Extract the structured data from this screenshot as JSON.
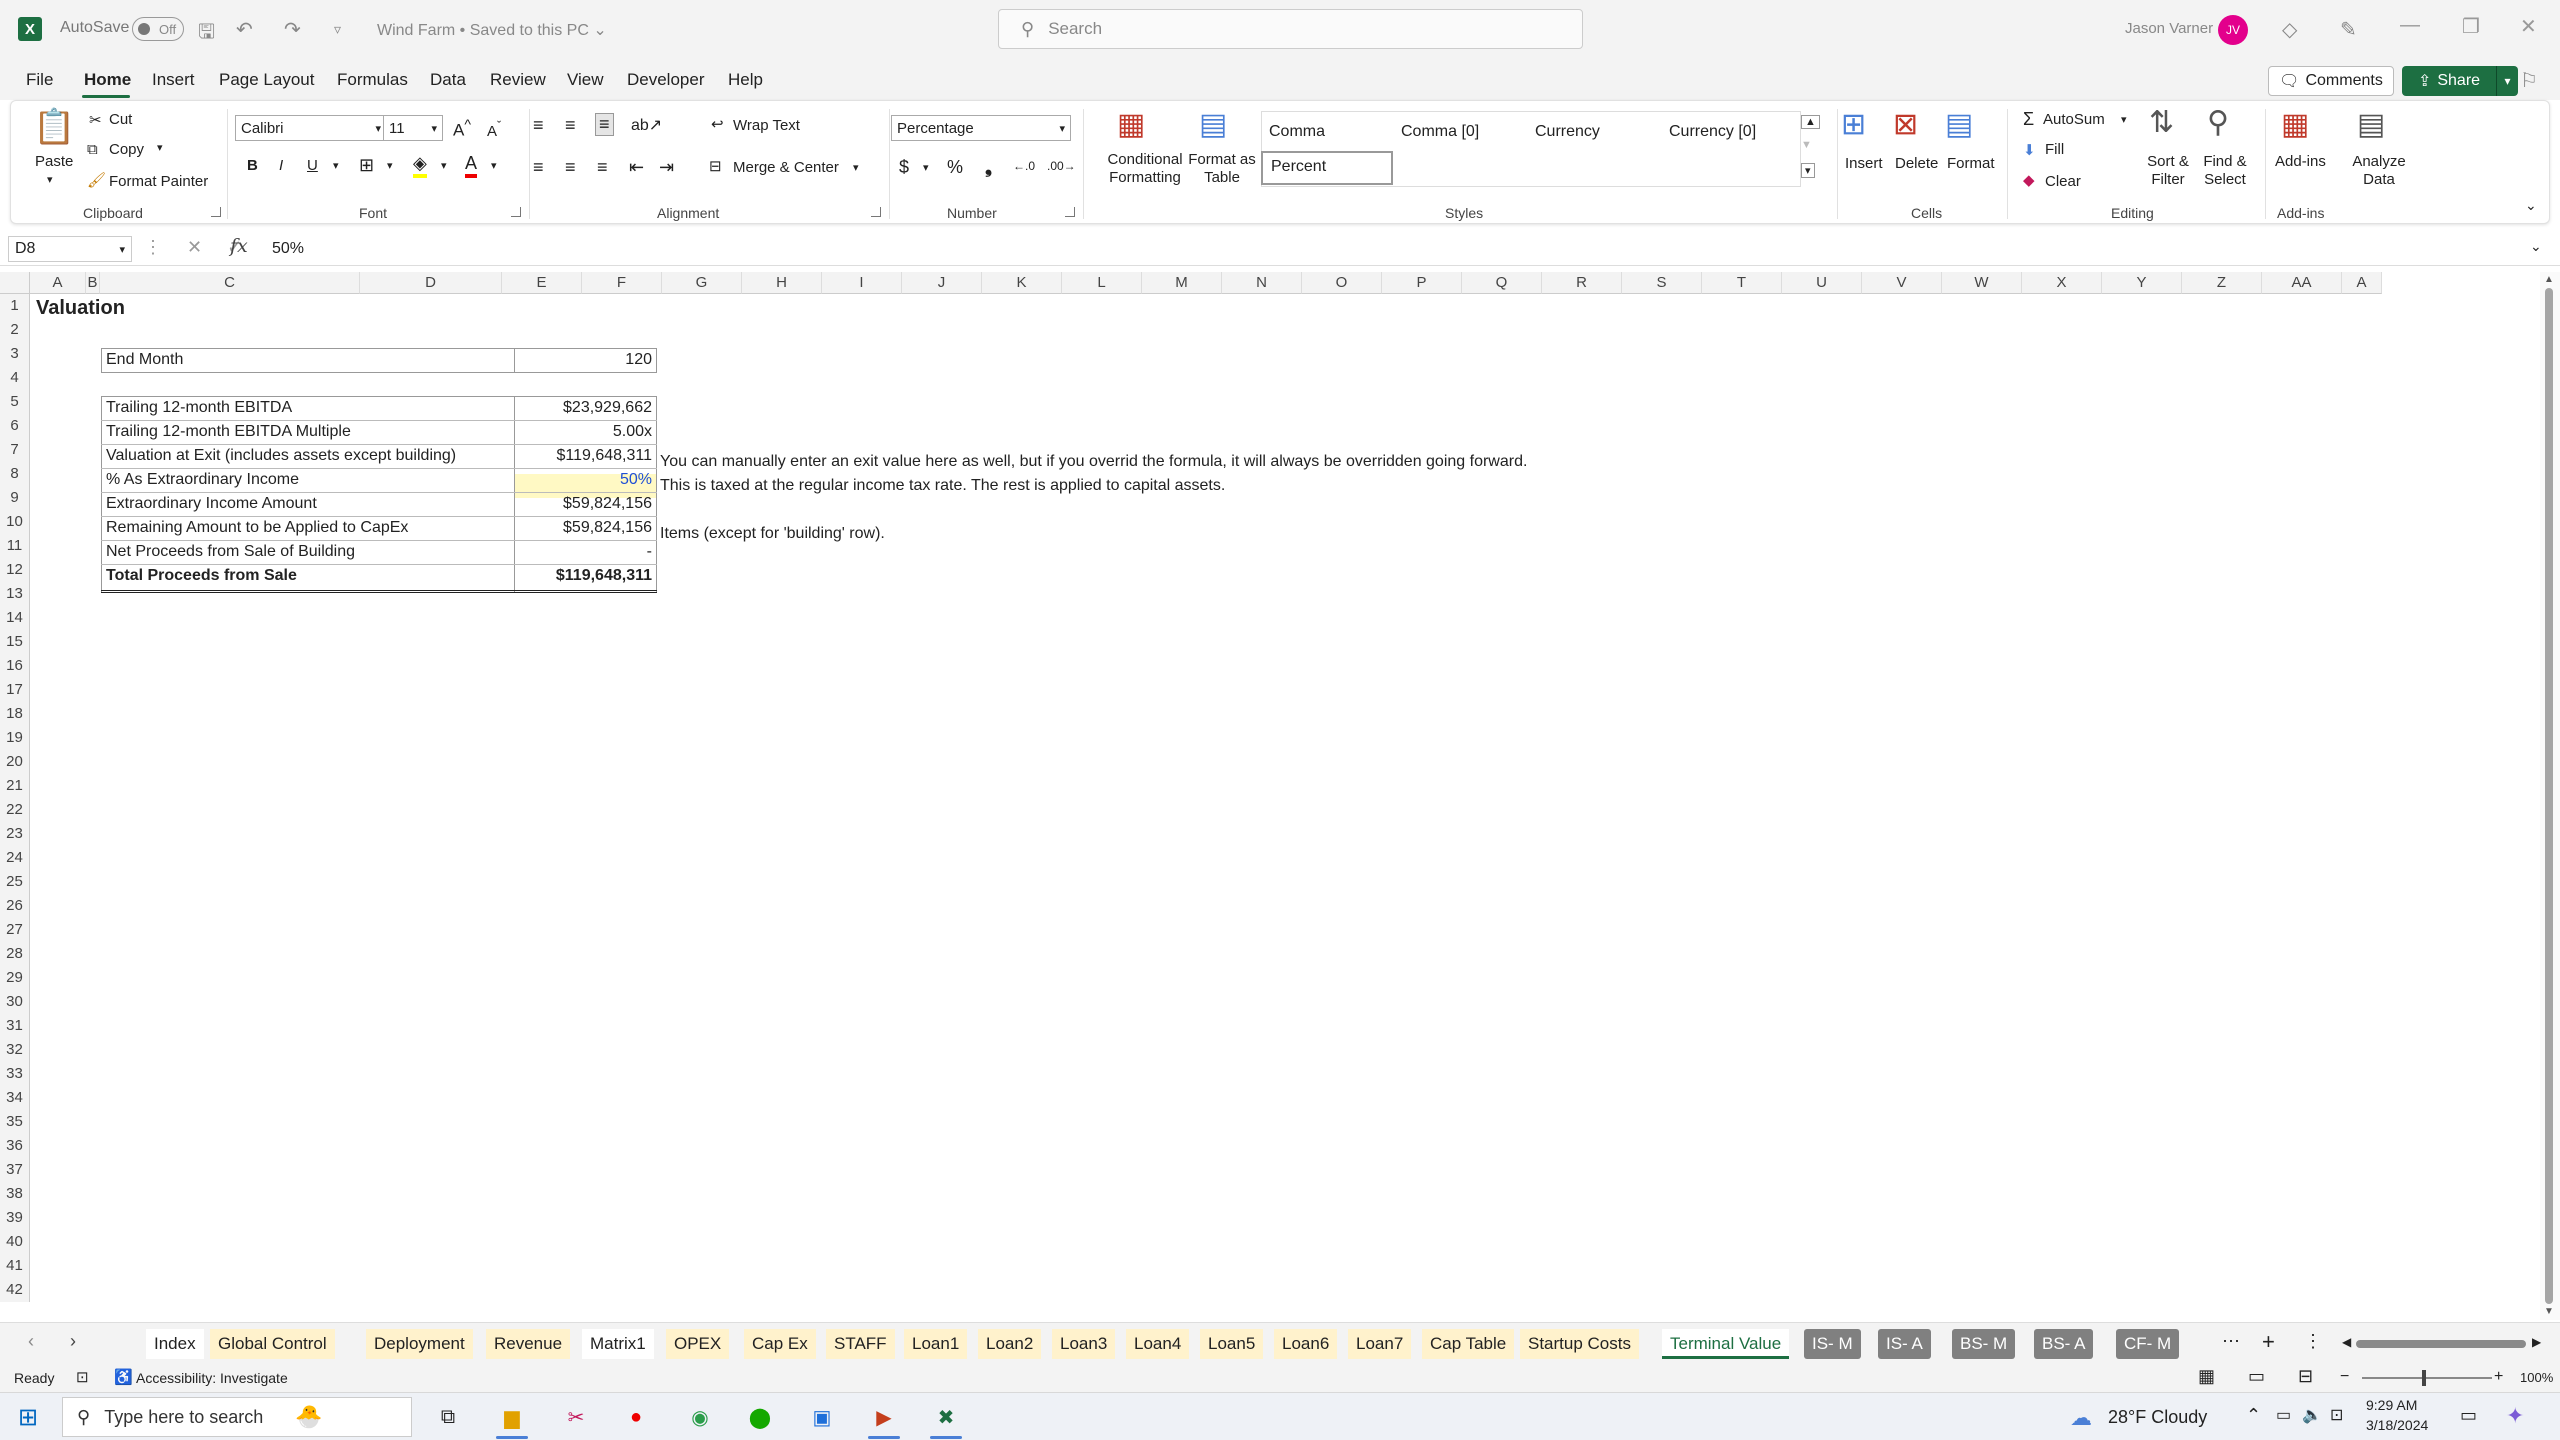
{
  "title_bar": {
    "app_letter": "X",
    "autosave_label": "AutoSave",
    "autosave_state": "Off",
    "doc_title": "Wind Farm • Saved to this PC ⌄",
    "search_placeholder": "Search",
    "user_name": "Jason Varner",
    "user_initials": "JV"
  },
  "menu": {
    "tabs": [
      "File",
      "Home",
      "Insert",
      "Page Layout",
      "Formulas",
      "Data",
      "Review",
      "View",
      "Developer",
      "Help"
    ],
    "comments_label": "Comments",
    "share_label": "Share"
  },
  "ribbon": {
    "clipboard": {
      "paste": "Paste",
      "cut": "Cut",
      "copy": "Copy",
      "format_painter": "Format Painter",
      "label": "Clipboard"
    },
    "font": {
      "name": "Calibri",
      "size": "11",
      "label": "Font"
    },
    "alignment": {
      "wrap_text": "Wrap Text",
      "merge_center": "Merge & Center",
      "label": "Alignment"
    },
    "number": {
      "format": "Percentage",
      "label": "Number"
    },
    "styles": {
      "conditional_formatting": "Conditional Formatting",
      "format_as_table": "Format as Table",
      "cells": [
        "Comma",
        "Comma [0]",
        "Currency",
        "Currency [0]"
      ],
      "selected_style": "Percent",
      "label": "Styles"
    },
    "cells": {
      "insert": "Insert",
      "delete": "Delete",
      "format": "Format",
      "label": "Cells"
    },
    "editing": {
      "autosum": "AutoSum",
      "fill": "Fill",
      "clear": "Clear",
      "sort_filter": "Sort & Filter",
      "find_select": "Find & Select",
      "label": "Editing"
    },
    "addins": {
      "addins": "Add-ins",
      "analyze_data": "Analyze Data",
      "label": "Add-ins"
    }
  },
  "formula_bar": {
    "name_box": "D8",
    "formula": "50%"
  },
  "grid": {
    "columns": [
      "A",
      "B",
      "C",
      "D",
      "E",
      "F",
      "G",
      "H",
      "I",
      "J",
      "K",
      "L",
      "M",
      "N",
      "O",
      "P",
      "Q",
      "R",
      "S",
      "T",
      "U",
      "V",
      "W",
      "X",
      "Y",
      "Z",
      "AA",
      "A"
    ],
    "rows": [
      "1",
      "2",
      "3",
      "4",
      "5",
      "6",
      "7",
      "8",
      "9",
      "10",
      "11",
      "12",
      "13",
      "14",
      "15",
      "16",
      "17",
      "18",
      "19",
      "20",
      "21",
      "22",
      "23",
      "24",
      "25",
      "26",
      "27",
      "28",
      "29",
      "30",
      "31",
      "32",
      "33",
      "34",
      "35",
      "36",
      "37",
      "38",
      "39",
      "40",
      "41",
      "42"
    ],
    "title": "Valuation",
    "end_month_label": "End Month",
    "end_month_value": "120",
    "table": [
      {
        "label": "Trailing 12-month EBITDA",
        "value": "$23,929,662"
      },
      {
        "label": "Trailing 12-month EBITDA Multiple",
        "value": "5.00x"
      },
      {
        "label": "Valuation at Exit (includes assets except building)",
        "value": "$119,648,311"
      },
      {
        "label": "% As Extraordinary Income",
        "value": "50%"
      },
      {
        "label": "Extraordinary Income Amount",
        "value": "$59,824,156"
      },
      {
        "label": "Remaining Amount to be Applied to CapEx",
        "value": "$59,824,156"
      },
      {
        "label": "Net Proceeds from Sale of Building",
        "value": "-"
      },
      {
        "label": "Total Proceeds from Sale",
        "value": "$119,648,311"
      }
    ],
    "notes": {
      "row7": "You can manually enter an exit value here as well, but if you overrid the formula, it will always be overridden going forward.",
      "row8": "This is taxed at the regular income tax rate. The rest is applied to capital assets.",
      "row10": "Items (except for 'building' row)."
    },
    "input_cell_color": "#fff9c4"
  },
  "sheet_tabs": [
    {
      "name": "Index",
      "style": "wht"
    },
    {
      "name": "Global Control",
      "style": "yel"
    },
    {
      "name": "Deployment",
      "style": "yel"
    },
    {
      "name": "Revenue",
      "style": "yel"
    },
    {
      "name": "Matrix1",
      "style": "wht"
    },
    {
      "name": "OPEX",
      "style": "yel"
    },
    {
      "name": "Cap Ex",
      "style": "yel"
    },
    {
      "name": "STAFF",
      "style": "yel"
    },
    {
      "name": "Loan1",
      "style": "yel"
    },
    {
      "name": "Loan2",
      "style": "yel"
    },
    {
      "name": "Loan3",
      "style": "yel"
    },
    {
      "name": "Loan4",
      "style": "yel"
    },
    {
      "name": "Loan5",
      "style": "yel"
    },
    {
      "name": "Loan6",
      "style": "yel"
    },
    {
      "name": "Loan7",
      "style": "yel"
    },
    {
      "name": "Cap Table",
      "style": "yel"
    },
    {
      "name": "Startup Costs",
      "style": "yel"
    },
    {
      "name": "Terminal Value",
      "style": "active"
    },
    {
      "name": "IS- M",
      "style": "gry"
    },
    {
      "name": "IS- A",
      "style": "gry"
    },
    {
      "name": "BS- M",
      "style": "gry"
    },
    {
      "name": "BS- A",
      "style": "gry"
    },
    {
      "name": "CF- M",
      "style": "gry"
    }
  ],
  "status_bar": {
    "ready": "Ready",
    "accessibility": "Accessibility: Investigate",
    "zoom": "100%"
  },
  "taskbar": {
    "search_placeholder": "Type here to search",
    "weather": "28°F  Cloudy",
    "time": "9:29 AM",
    "date": "3/18/2024"
  },
  "colors": {
    "excel_green": "#1d6f42",
    "tab_yellow": "#fff2cc",
    "tab_gray": "#808080",
    "avatar": "#e3008c"
  }
}
